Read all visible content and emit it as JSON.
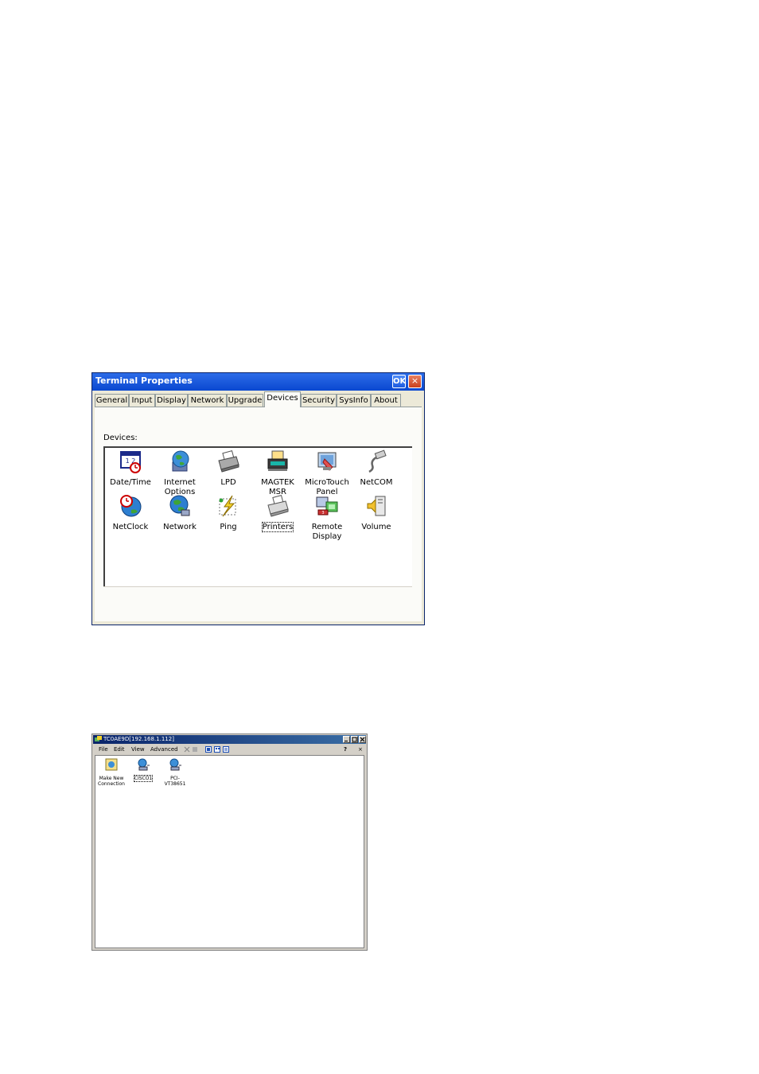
{
  "terminal_properties": {
    "title": "Terminal Properties",
    "ok_label": "OK",
    "close_label": "×",
    "tabs": [
      {
        "label": "General"
      },
      {
        "label": "Input"
      },
      {
        "label": "Display"
      },
      {
        "label": "Network"
      },
      {
        "label": "Upgrade"
      },
      {
        "label": "Devices"
      },
      {
        "label": "Security"
      },
      {
        "label": "SysInfo"
      },
      {
        "label": "About"
      }
    ],
    "active_tab": "Devices",
    "devices_label": "Devices:",
    "devices": [
      {
        "line1": "Date/Time",
        "line2": "",
        "icon": "calendar-clock-icon"
      },
      {
        "line1": "Internet",
        "line2": "Options",
        "icon": "globe-monitor-icon"
      },
      {
        "line1": "LPD",
        "line2": "",
        "icon": "printer-icon"
      },
      {
        "line1": "MAGTEK",
        "line2": "MSR",
        "icon": "card-reader-icon"
      },
      {
        "line1": "MicroTouch",
        "line2": "Panel",
        "icon": "touch-panel-icon"
      },
      {
        "line1": "NetCOM",
        "line2": "",
        "icon": "serial-cable-icon"
      },
      {
        "line1": "NetClock",
        "line2": "",
        "icon": "globe-clock-icon"
      },
      {
        "line1": "Network",
        "line2": "",
        "icon": "network-globe-icon"
      },
      {
        "line1": "Ping",
        "line2": "",
        "icon": "ping-icon"
      },
      {
        "line1": "Printers",
        "line2": "",
        "icon": "printers-icon"
      },
      {
        "line1": "Remote",
        "line2": "Display",
        "icon": "remote-display-icon"
      },
      {
        "line1": "Volume",
        "line2": "",
        "icon": "speaker-icon"
      }
    ],
    "focused_device": "Printers"
  },
  "connection_manager": {
    "title": "TC0AE9D[192.168.1.112]",
    "menu": [
      {
        "label": "File"
      },
      {
        "label": "Edit"
      },
      {
        "label": "View"
      },
      {
        "label": "Advanced"
      }
    ],
    "help_label": "?",
    "close_label": "×",
    "connections": [
      {
        "line1": "Make New",
        "line2": "Connection",
        "icon": "new-connection-icon"
      },
      {
        "line1": "CISCO1",
        "line2": "",
        "icon": "connection-icon"
      },
      {
        "line1": "PCI-",
        "line2": "VT38651",
        "icon": "connection-icon"
      }
    ],
    "selected_connection": "CISCO1"
  }
}
